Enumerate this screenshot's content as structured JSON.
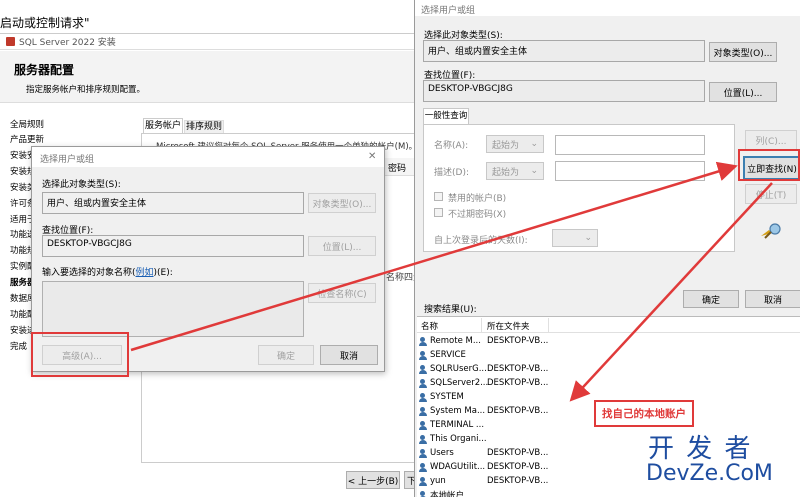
{
  "top_caption": "启动或控制请求\"",
  "setup": {
    "title": "SQL Server 2022 安装",
    "heading": "服务器配置",
    "subheading": "指定服务帐户和排序规则配置。",
    "sidebar": [
      "全局规则",
      "产品更新",
      "安装安",
      "安装规",
      "安装类",
      "许可条",
      "适用于",
      "功能选",
      "功能规",
      "实例配",
      "服务器",
      "数据库",
      "功能配",
      "安装进",
      "完成"
    ],
    "tabs": [
      "服务帐户",
      "排序规则"
    ],
    "tab_text": "Microsoft 建议您对每个 SQL Server 服务使用一个单独的帐户(M)。",
    "col_password": "密码",
    "side_text": "名称四元",
    "back_button": "< 上一步(B)",
    "next_button": "下"
  },
  "small_dialog": {
    "title": "选择用户或组",
    "close": "✕",
    "obj_type_label": "选择此对象类型(S):",
    "obj_type_value": "用户、组或内置安全主体",
    "obj_type_btn": "对象类型(O)...",
    "location_label": "查找位置(F):",
    "location_value": "DESKTOP-VBGCJ8G",
    "location_btn": "位置(L)...",
    "enter_label": "输入要选择的对象名称(",
    "enter_link": "例如",
    "enter_label_end": ")(E):",
    "check_btn": "检查名称(C)",
    "advanced_btn": "高级(A)...",
    "ok_btn": "确定",
    "cancel_btn": "取消"
  },
  "big_dialog": {
    "title": "选择用户或组",
    "obj_type_label": "选择此对象类型(S):",
    "obj_type_value": "用户、组或内置安全主体",
    "obj_type_btn": "对象类型(O)...",
    "location_label": "查找位置(F):",
    "location_value": "DESKTOP-VBGCJ8G",
    "location_btn": "位置(L)...",
    "tab_general": "一般性查询",
    "name_label": "名称(A):",
    "desc_label": "描述(D):",
    "starts_with": "起始为",
    "columns_btn": "列(C)...",
    "find_now_btn": "立即查找(N)",
    "stop_btn": "停止(T)",
    "disabled_accounts": "禁用的帐户(B)",
    "no_expire": "不过期密码(X)",
    "days_label": "自上次登录后的天数(I):",
    "ok_btn": "确定",
    "cancel_btn": "取消",
    "results_label": "搜索结果(U):",
    "col_name": "名称",
    "col_folder": "所在文件夹",
    "results": [
      {
        "name": "Remote M...",
        "folder": "DESKTOP-VB..."
      },
      {
        "name": "SERVICE",
        "folder": ""
      },
      {
        "name": "SQLRUserG...",
        "folder": "DESKTOP-VB..."
      },
      {
        "name": "SQLServer2...",
        "folder": "DESKTOP-VB..."
      },
      {
        "name": "SYSTEM",
        "folder": ""
      },
      {
        "name": "System Ma...",
        "folder": "DESKTOP-VB..."
      },
      {
        "name": "TERMINAL ...",
        "folder": ""
      },
      {
        "name": "This Organi...",
        "folder": ""
      },
      {
        "name": "Users",
        "folder": "DESKTOP-VB..."
      },
      {
        "name": "WDAGUtilit...",
        "folder": "DESKTOP-VB..."
      },
      {
        "name": "yun",
        "folder": "DESKTOP-VB..."
      },
      {
        "name": "本地帐户",
        "folder": ""
      }
    ]
  },
  "annotation": {
    "text": "找自己的本地账户",
    "color": "#e03a3a"
  },
  "watermark": {
    "line1": "开 发 者",
    "line2": "DevZe.CoM"
  }
}
